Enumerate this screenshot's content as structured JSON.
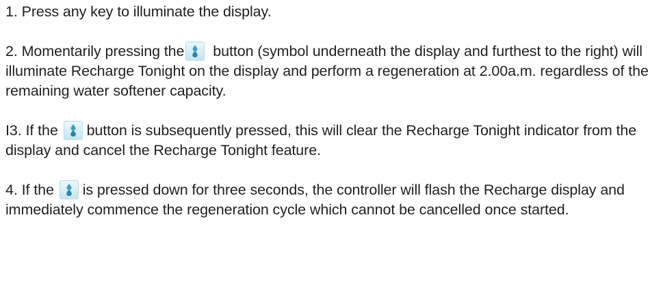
{
  "instructions": {
    "step1": "1. Press any key to illuminate the display.",
    "step2_before": "2. Momentarily pressing the",
    "step2_after": "button (symbol underneath the display and furthest to the right) will illuminate Recharge Tonight on the display and perform a regeneration at 2.00a.m. regardless of the remaining water softener capacity.",
    "step3_before": "I3. If the",
    "step3_after": "button is subsequently pressed, this will clear the Recharge Tonight indicator from the display and cancel the Recharge Tonight feature.",
    "step4_before": "4. If the",
    "step4_after": "is pressed down for three seconds, the controller will flash the Recharge display and immediately commence the regeneration cycle which cannot be cancelled once started."
  },
  "icon": {
    "name": "water-drops-icon",
    "background": "#d7eef5",
    "drop_color": "#2f8fb0"
  }
}
